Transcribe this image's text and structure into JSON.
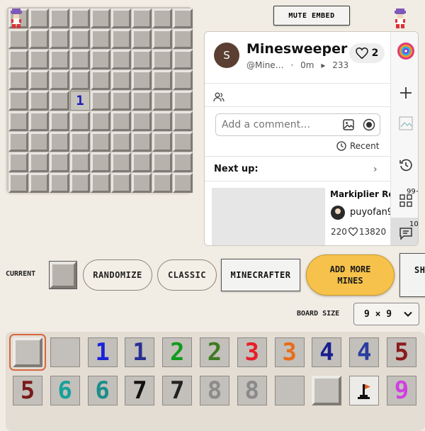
{
  "board": {
    "size": 9,
    "revealed": [
      {
        "row": 4,
        "col": 3,
        "value": "1"
      }
    ]
  },
  "mute_button": {
    "label": "MUTE EMBED"
  },
  "embed": {
    "avatar_letter": "S",
    "title": "Minesweeper p…",
    "channel": "@Mine…",
    "age": "0m",
    "views": "233",
    "likes": "2",
    "comment_placeholder": "Add a comment…",
    "sort_label": "Recent",
    "next_up_label": "Next up:",
    "next_video_title": "Markiplier Re…",
    "next_channel": "puyofan9…",
    "next_likes": "220",
    "next_views": "13820",
    "rail_badges": {
      "apps": "99+",
      "chat": "10"
    }
  },
  "controls": {
    "current_label": "CURRENT",
    "randomize_label": "RANDOMIZE",
    "classic_label": "CLASSIC",
    "minecrafter_label": "MINECRAFTER",
    "add_mines_label_line1": "ADD MORE",
    "add_mines_label_line2": "MINES",
    "partial_button_label": "SH",
    "board_size_label": "BOARD SIZE",
    "board_size_value": "9 × 9"
  },
  "skins": [
    {
      "kind": "raised",
      "text": "",
      "color": "#c3c0bb",
      "selected": true
    },
    {
      "kind": "flat",
      "text": "",
      "color": "#c3c0bb"
    },
    {
      "kind": "flat",
      "text": "1",
      "color": "#1a22d8"
    },
    {
      "kind": "flat",
      "text": "1",
      "color": "#2a2f93"
    },
    {
      "kind": "flat",
      "text": "2",
      "color": "#119a1d"
    },
    {
      "kind": "flat",
      "text": "2",
      "color": "#3f7a24"
    },
    {
      "kind": "flat",
      "text": "3",
      "color": "#e6202a"
    },
    {
      "kind": "flat",
      "text": "3",
      "color": "#e86d1a"
    },
    {
      "kind": "flat",
      "text": "4",
      "color": "#1a1f8f"
    },
    {
      "kind": "flat",
      "text": "4",
      "color": "#2b3d9e"
    },
    {
      "kind": "flat",
      "text": "5",
      "color": "#8a1c1c"
    },
    {
      "kind": "flat",
      "text": "5",
      "color": "#7a1a1a"
    },
    {
      "kind": "flat",
      "text": "6",
      "color": "#1aa09a"
    },
    {
      "kind": "flat",
      "text": "6",
      "color": "#1c8e8a"
    },
    {
      "kind": "flat",
      "text": "7",
      "color": "#111111"
    },
    {
      "kind": "flat",
      "text": "7",
      "color": "#222222"
    },
    {
      "kind": "flat",
      "text": "8",
      "color": "#8c8c8c"
    },
    {
      "kind": "flat",
      "text": "8",
      "color": "#8a8a8a"
    },
    {
      "kind": "flat",
      "text": "",
      "color": "#c3c0bb"
    },
    {
      "kind": "raised",
      "text": "",
      "color": "#c3c0bb"
    },
    {
      "kind": "flag",
      "text": "",
      "color": "#e05d20"
    },
    {
      "kind": "flat",
      "text": "9",
      "color": "#d040e0"
    }
  ],
  "colors": {
    "background": "#f1ece4",
    "accent": "#f7c24b",
    "selection": "#d8673f"
  }
}
